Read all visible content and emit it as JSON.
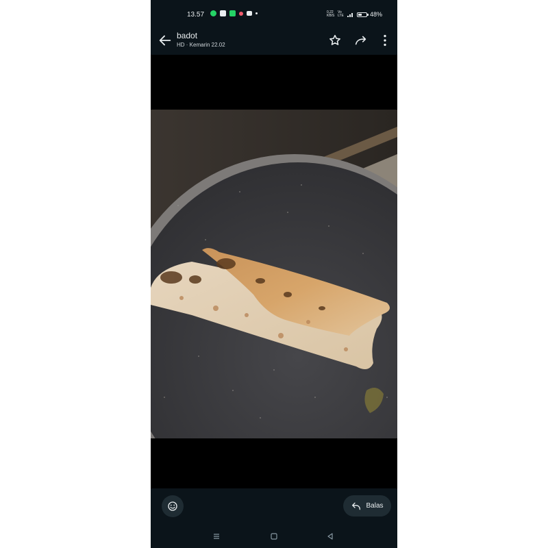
{
  "status_bar": {
    "time": "13.57",
    "network_speed": "0,22 KB/S",
    "network_type": "Vo LTE",
    "battery": "48%",
    "battery_level": 0.48
  },
  "header": {
    "sender": "badot",
    "meta": "HD · Kemarin 22.02"
  },
  "photo": {
    "description_icon": "photo"
  },
  "footer": {
    "reply_label": "Balas"
  },
  "colors": {
    "background": "#0b141a",
    "accent": "#25d366",
    "text": "#e9edef"
  }
}
